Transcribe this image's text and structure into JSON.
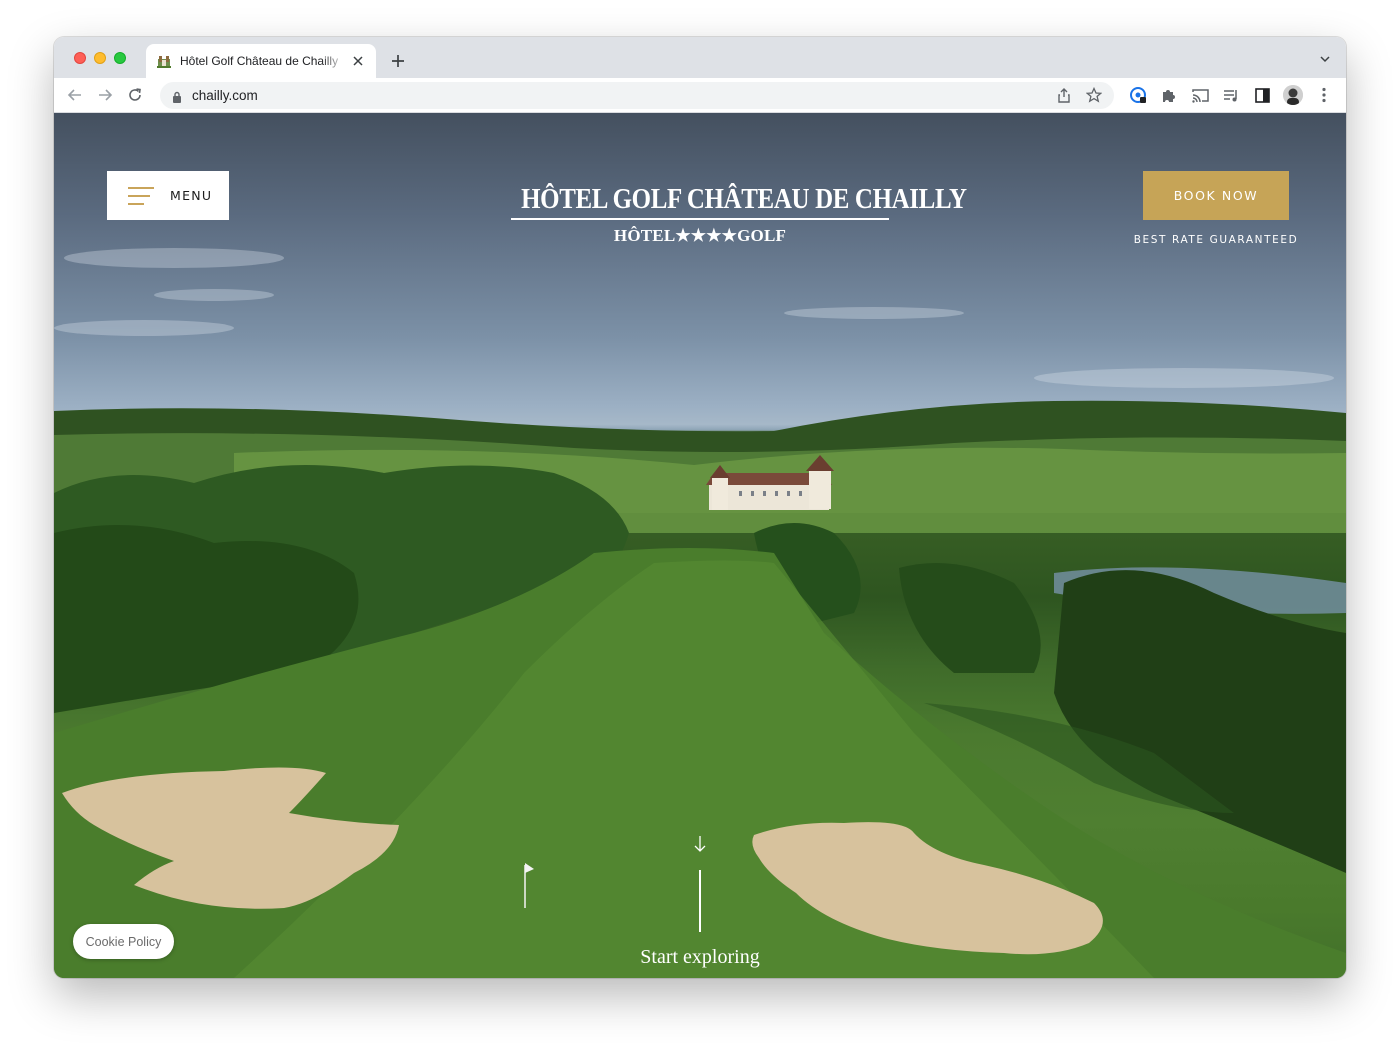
{
  "browser": {
    "tab": {
      "title": "Hôtel Golf Château de Chailly",
      "favicon": "chateau-favicon"
    },
    "address_bar": {
      "url": "chailly.com"
    }
  },
  "site": {
    "menu_label": "MENU",
    "brand": {
      "title": "HÔTEL GOLF CHÂTEAU DE CHAILLY",
      "subtitle": "HÔTEL★★★★GOLF"
    },
    "book_label": "BOOK NOW",
    "rate_note": "BEST RATE GUARANTEED",
    "explore_label": "Start exploring",
    "cookie_label": "Cookie Policy"
  },
  "colors": {
    "accent_gold": "#c6a457",
    "hamburger_gold": "#c9a45a"
  }
}
